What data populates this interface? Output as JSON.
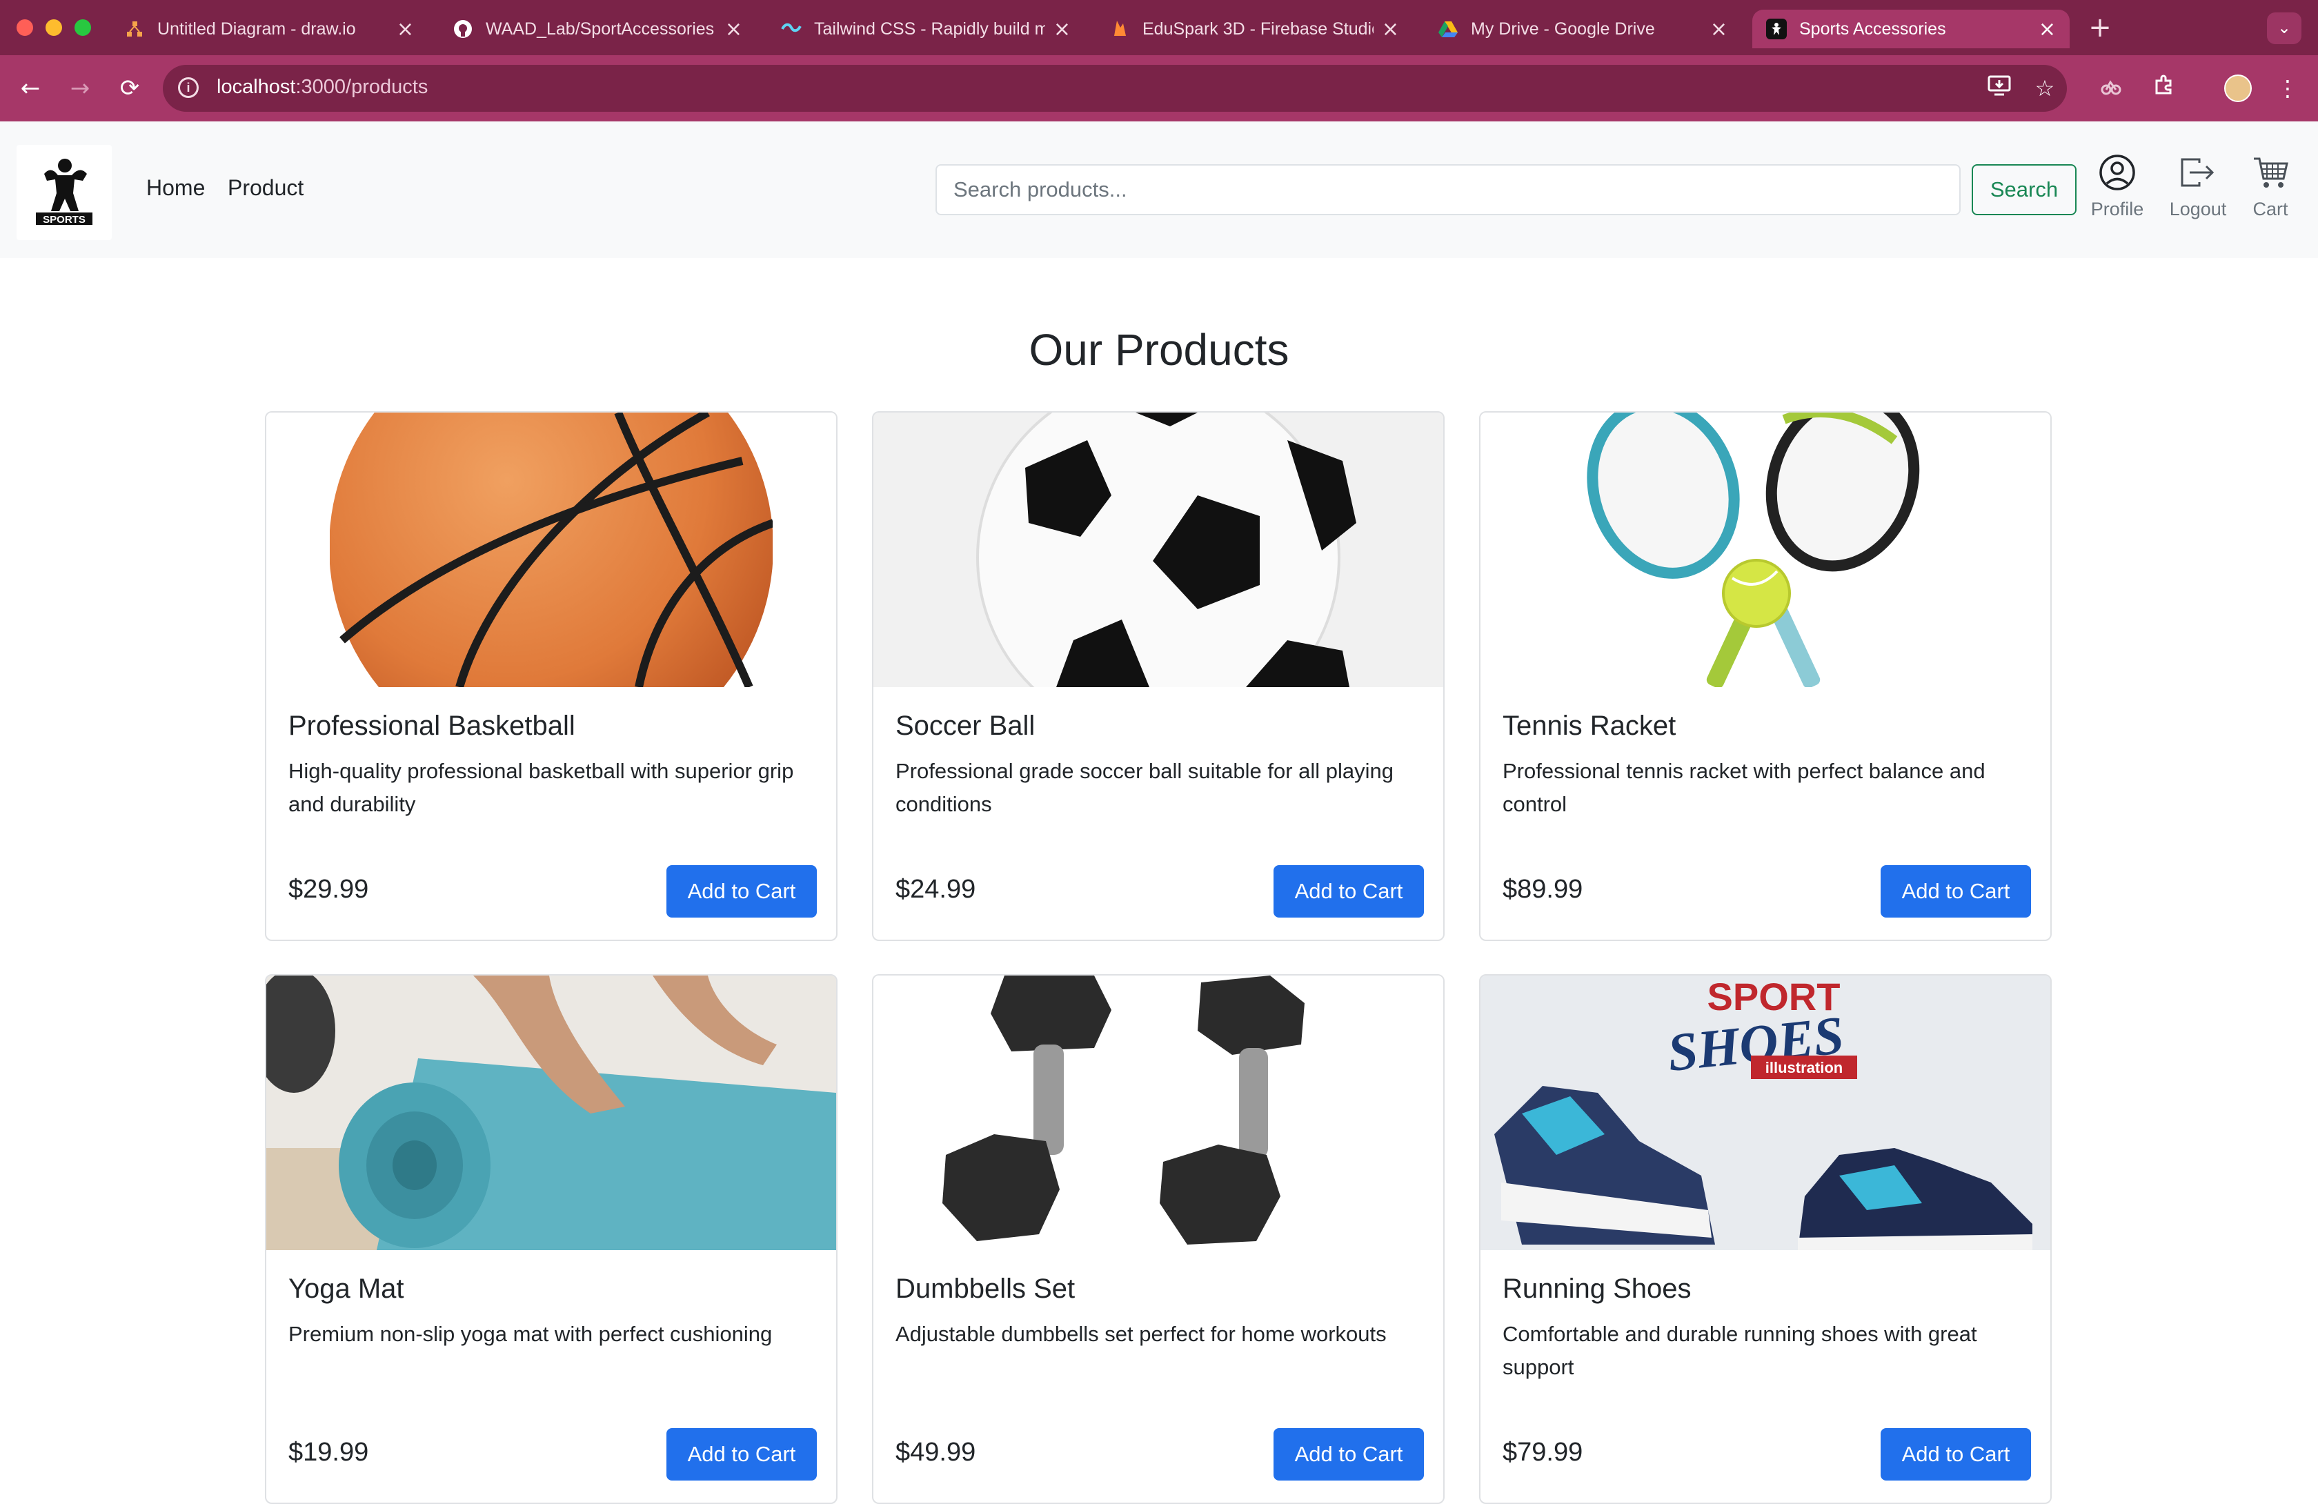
{
  "browser": {
    "tabs": [
      {
        "title": "Untitled Diagram - draw.io",
        "icon": "drawio-icon"
      },
      {
        "title": "WAAD_Lab/SportAccessories",
        "icon": "github-icon"
      },
      {
        "title": "Tailwind CSS - Rapidly build m",
        "icon": "tailwind-icon"
      },
      {
        "title": "EduSpark 3D - Firebase Studio",
        "icon": "firebase-icon"
      },
      {
        "title": "My Drive - Google Drive",
        "icon": "google-drive-icon"
      },
      {
        "title": "Sports Accessories",
        "icon": "sports-site-icon",
        "active": true
      }
    ],
    "new_tab": "+",
    "address": {
      "host": "localhost",
      "path": ":3000/products"
    },
    "theme_colors": {
      "tabbar": "#7a2348",
      "toolbar": "#a63768"
    }
  },
  "navbar": {
    "brand_text": "SPORTS",
    "links": [
      "Home",
      "Product"
    ],
    "search": {
      "placeholder": "Search products...",
      "value": "",
      "button_label": "Search"
    },
    "actions": [
      {
        "label": "Profile",
        "icon": "person-circle-icon"
      },
      {
        "label": "Logout",
        "icon": "logout-icon"
      },
      {
        "label": "Cart",
        "icon": "cart-icon"
      }
    ]
  },
  "main": {
    "title": "Our Products",
    "add_to_cart_label": "Add to Cart",
    "products": [
      {
        "name": "Professional Basketball",
        "description": "High-quality professional basketball with superior grip and durability",
        "price": "$29.99",
        "image": "basketball"
      },
      {
        "name": "Soccer Ball",
        "description": "Professional grade soccer ball suitable for all playing conditions",
        "price": "$24.99",
        "image": "soccer-ball"
      },
      {
        "name": "Tennis Racket",
        "description": "Professional tennis racket with perfect balance and control",
        "price": "$89.99",
        "image": "tennis-rackets"
      },
      {
        "name": "Yoga Mat",
        "description": "Premium non-slip yoga mat with perfect cushioning",
        "price": "$19.99",
        "image": "yoga-mat"
      },
      {
        "name": "Dumbbells Set",
        "description": "Adjustable dumbbells set perfect for home workouts",
        "price": "$49.99",
        "image": "dumbbells"
      },
      {
        "name": "Running Shoes",
        "description": "Comfortable and durable running shoes with great support",
        "price": "$79.99",
        "image": "sport-shoes",
        "image_text": {
          "line1": "SPORT",
          "line2": "SHOES",
          "line3": "illustration"
        }
      }
    ],
    "colors": {
      "primary": "#2170ec",
      "success": "#198754"
    }
  }
}
